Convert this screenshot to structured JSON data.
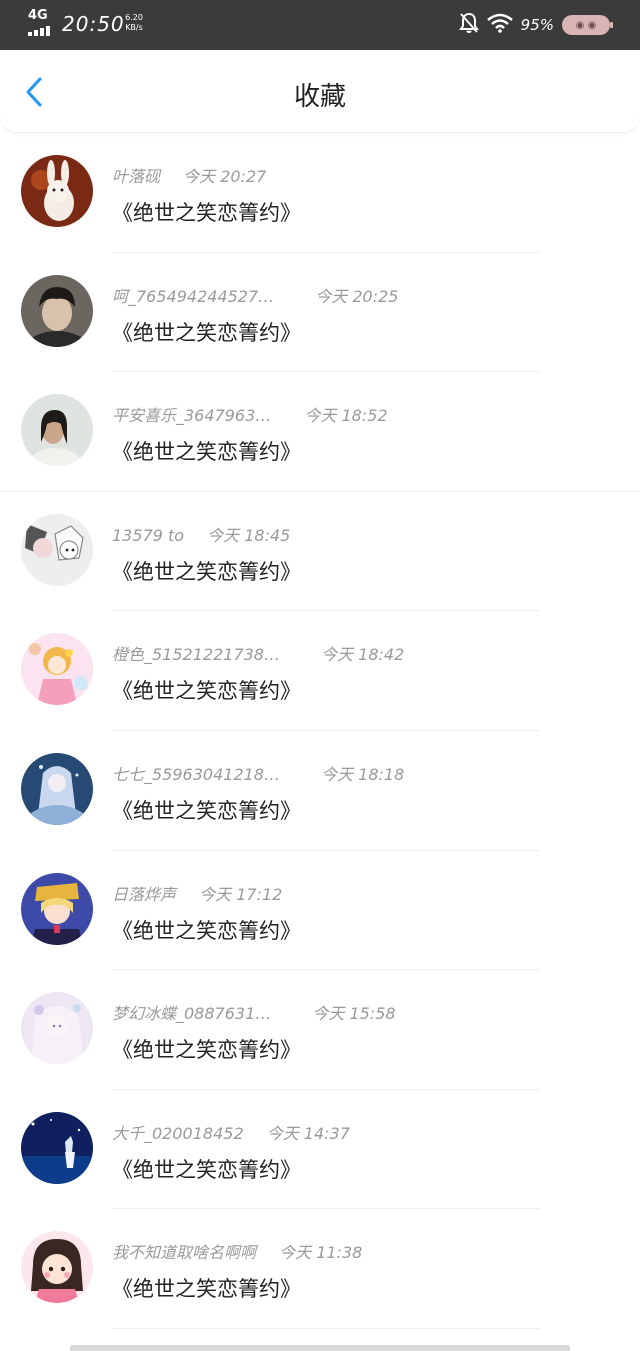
{
  "status_bar": {
    "network": "4G",
    "time": "20:50",
    "speed_value": "6.20",
    "speed_unit": "KB/s",
    "battery_percent": "95%"
  },
  "header": {
    "title": "收藏",
    "back_icon": "chevron-left-icon",
    "accent_color": "#2196f3"
  },
  "favorites": [
    {
      "name": "叶落砚",
      "time": "今天 20:27",
      "content": "《绝世之笑恋箐约》"
    },
    {
      "name": "呵_765494244527…",
      "time": "今天 20:25",
      "content": "《绝世之笑恋箐约》"
    },
    {
      "name": "平安喜乐_3647963…",
      "time": "今天 18:52",
      "content": "《绝世之笑恋箐约》"
    },
    {
      "name": "13579 to",
      "time": "今天 18:45",
      "content": "《绝世之笑恋箐约》"
    },
    {
      "name": "橙色_51521221738…",
      "time": "今天 18:42",
      "content": "《绝世之笑恋箐约》"
    },
    {
      "name": "七七_55963041218…",
      "time": "今天 18:18",
      "content": "《绝世之笑恋箐约》"
    },
    {
      "name": "日落烨声",
      "time": "今天 17:12",
      "content": "《绝世之笑恋箐约》"
    },
    {
      "name": "梦幻冰蝶_0887631…",
      "time": "今天 15:58",
      "content": "《绝世之笑恋箐约》"
    },
    {
      "name": "大千_020018452",
      "time": "今天 14:37",
      "content": "《绝世之笑恋箐约》"
    },
    {
      "name": "我不知道取啥名啊啊",
      "time": "今天 11:38",
      "content": "《绝世之笑恋箐约》"
    }
  ]
}
